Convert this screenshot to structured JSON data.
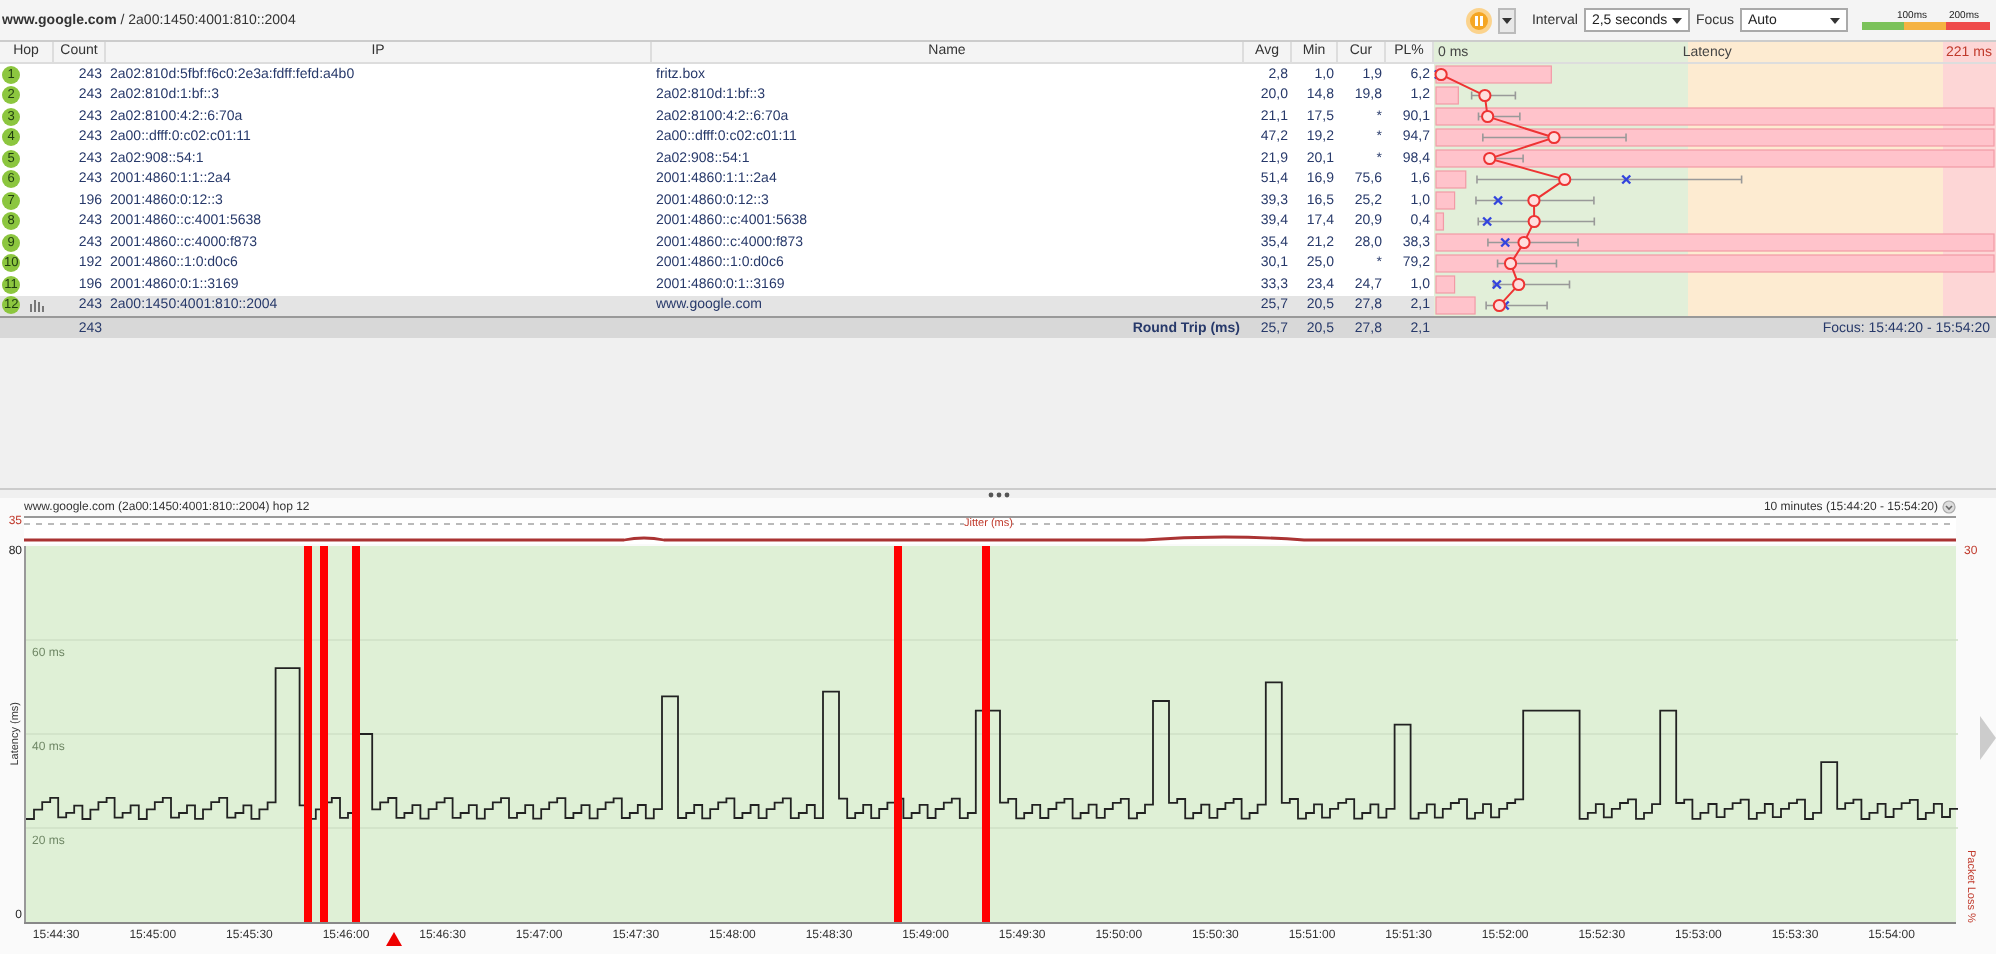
{
  "breadcrumb": "**www.google.com** / 2a00:1450:4001:810::2004",
  "toolbar": {
    "interval_label": "Interval",
    "interval": "2,5 seconds",
    "focus_label": "Focus",
    "focus": "Auto",
    "legend": [
      "100ms",
      "200ms"
    ]
  },
  "columns": [
    "Hop",
    "Count",
    "IP",
    "Name",
    "Avg",
    "Min",
    "Cur",
    "PL%"
  ],
  "latency_header": {
    "min": "0 ms",
    "title": "Latency",
    "max": "221 ms"
  },
  "hops": [
    {
      "hop": "1",
      "count": "243",
      "ip": "2a02:810d:5fbf:f6c0:2e3a:fdff:fefd:a4b0",
      "name": "fritz.box",
      "avg": "2,8",
      "min": "1,0",
      "cur": "1,9",
      "pl": "6,2",
      "selected": false
    },
    {
      "hop": "2",
      "count": "243",
      "ip": "2a02:810d:1:bf::3",
      "name": "2a02:810d:1:bf::3",
      "avg": "20,0",
      "min": "14,8",
      "cur": "19,8",
      "pl": "1,2",
      "selected": false
    },
    {
      "hop": "3",
      "count": "243",
      "ip": "2a02:8100:4:2::6:70a",
      "name": "2a02:8100:4:2::6:70a",
      "avg": "21,1",
      "min": "17,5",
      "cur": "*",
      "pl": "90,1",
      "selected": false
    },
    {
      "hop": "4",
      "count": "243",
      "ip": "2a00::dfff:0:c02:c01:11",
      "name": "2a00::dfff:0:c02:c01:11",
      "avg": "47,2",
      "min": "19,2",
      "cur": "*",
      "pl": "94,7",
      "selected": false
    },
    {
      "hop": "5",
      "count": "243",
      "ip": "2a02:908::54:1",
      "name": "2a02:908::54:1",
      "avg": "21,9",
      "min": "20,1",
      "cur": "*",
      "pl": "98,4",
      "selected": false
    },
    {
      "hop": "6",
      "count": "243",
      "ip": "2001:4860:1:1::2a4",
      "name": "2001:4860:1:1::2a4",
      "avg": "51,4",
      "min": "16,9",
      "cur": "75,6",
      "pl": "1,6",
      "selected": false
    },
    {
      "hop": "7",
      "count": "196",
      "ip": "2001:4860:0:12::3",
      "name": "2001:4860:0:12::3",
      "avg": "39,3",
      "min": "16,5",
      "cur": "25,2",
      "pl": "1,0",
      "selected": false
    },
    {
      "hop": "8",
      "count": "243",
      "ip": "2001:4860::c:4001:5638",
      "name": "2001:4860::c:4001:5638",
      "avg": "39,4",
      "min": "17,4",
      "cur": "20,9",
      "pl": "0,4",
      "selected": false
    },
    {
      "hop": "9",
      "count": "243",
      "ip": "2001:4860::c:4000:f873",
      "name": "2001:4860::c:4000:f873",
      "avg": "35,4",
      "min": "21,2",
      "cur": "28,0",
      "pl": "38,3",
      "selected": false
    },
    {
      "hop": "10",
      "count": "192",
      "ip": "2001:4860::1:0:d0c6",
      "name": "2001:4860::1:0:d0c6",
      "avg": "30,1",
      "min": "25,0",
      "cur": "*",
      "pl": "79,2",
      "selected": false
    },
    {
      "hop": "11",
      "count": "196",
      "ip": "2001:4860:0:1::3169",
      "name": "2001:4860:0:1::3169",
      "avg": "33,3",
      "min": "23,4",
      "cur": "24,7",
      "pl": "1,0",
      "selected": false
    },
    {
      "hop": "12",
      "count": "243",
      "ip": "2a00:1450:4001:810::2004",
      "name": "www.google.com",
      "avg": "25,7",
      "min": "20,5",
      "cur": "27,8",
      "pl": "2,1",
      "selected": true
    }
  ],
  "round_trip": {
    "count": "243",
    "label": "Round Trip (ms)",
    "avg": "25,7",
    "min": "20,5",
    "cur": "27,8",
    "pl": "2,1",
    "focus": "Focus: 15:44:20 - 15:54:20"
  },
  "chart": {
    "title": "www.google.com (2a00:1450:4001:810::2004) hop 12",
    "range": "10 minutes (15:44:20 - 15:54:20)",
    "jitter_label": "Jitter (ms)",
    "jitter_max": "35",
    "latency_max": "80",
    "latency_min": "0",
    "loss_max": "30",
    "ylabel": "Latency (ms)",
    "y2label": "Packet Loss %",
    "gridlines": [
      "60 ms",
      "40 ms",
      "20 ms"
    ],
    "x_labels": [
      "15:44:30",
      "15:45:00",
      "15:45:30",
      "15:46:00",
      "15:46:30",
      "15:47:00",
      "15:47:30",
      "15:48:00",
      "15:48:30",
      "15:49:00",
      "15:49:30",
      "15:50:00",
      "15:50:30",
      "15:51:00",
      "15:51:30",
      "15:52:00",
      "15:52:30",
      "15:53:00",
      "15:53:30",
      "15:54:00"
    ]
  }
}
